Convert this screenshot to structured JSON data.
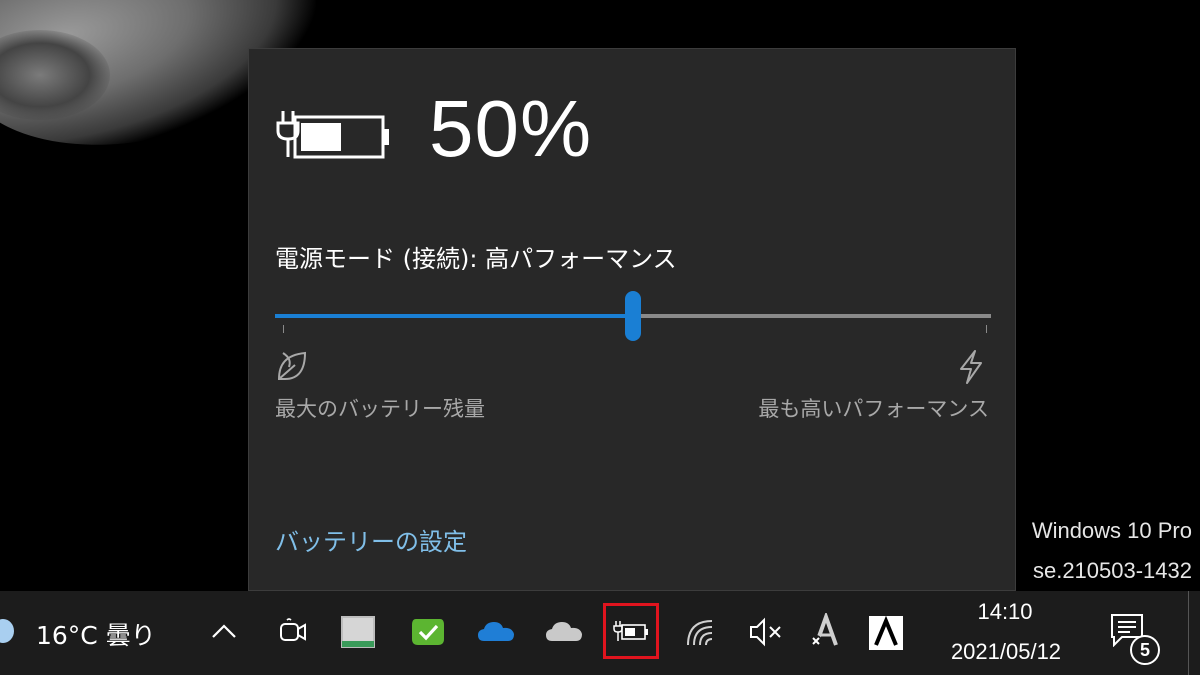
{
  "battery_flyout": {
    "percent": "50%",
    "power_mode_label": "電源モード (接続): 高パフォーマンス",
    "slider": {
      "value_fraction": 0.5
    },
    "min_label": "最大のバッテリー残量",
    "max_label": "最も高いパフォーマンス",
    "settings_link": "バッテリーの設定",
    "colors": {
      "accent": "#1a7fd4",
      "link": "#80bfe9",
      "background": "#282828"
    }
  },
  "watermark": {
    "line1": "Windows 10 Pro",
    "line2": "se.210503-1432"
  },
  "taskbar": {
    "weather": {
      "icon": "weather-icon",
      "text": "16°C  曇り"
    },
    "tray_icons": [
      "chevron-up-icon",
      "meet-now-icon",
      "app-window-icon",
      "check-app-icon",
      "onedrive-icon",
      "onedrive-gray-icon",
      "battery-icon",
      "wifi-icon",
      "volume-muted-icon",
      "font-a-icon",
      "ime-a-icon"
    ],
    "clock": {
      "time": "14:10",
      "date": "2021/05/12"
    },
    "notifications": {
      "count": "5"
    },
    "highlight_color": "#e0141e"
  }
}
